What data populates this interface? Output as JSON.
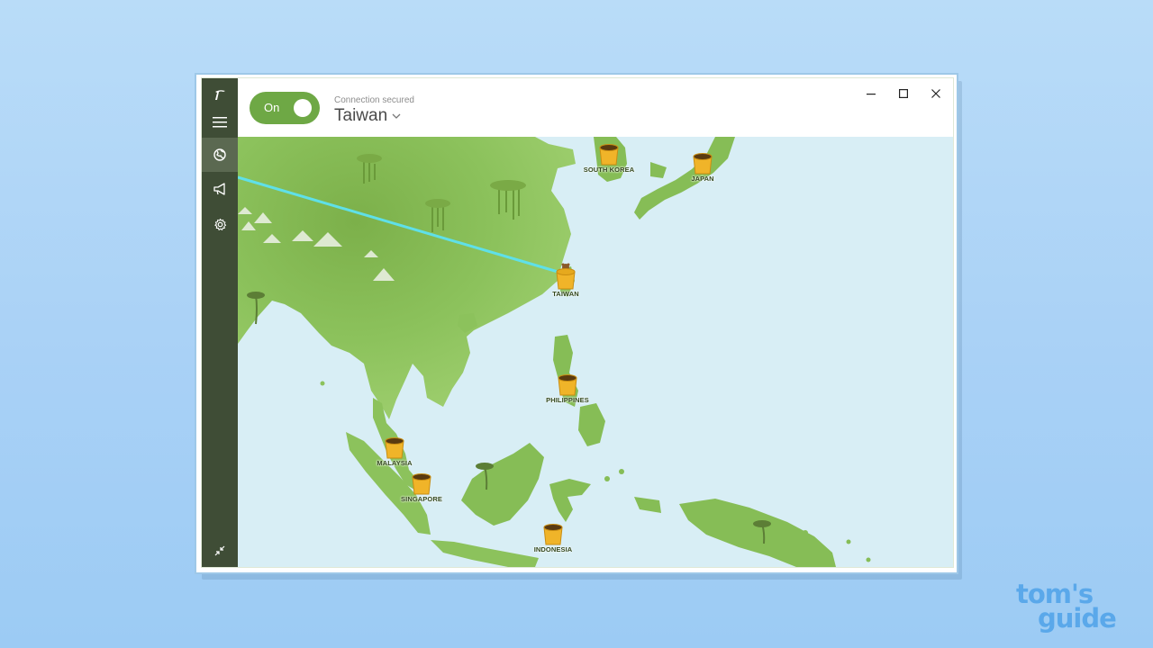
{
  "header": {
    "toggle_label": "On",
    "connection_status": "Connection secured",
    "selected_country": "Taiwan"
  },
  "sidebar": {
    "items": [
      {
        "icon": "tunnelbear-logo-icon"
      },
      {
        "icon": "menu-icon"
      },
      {
        "icon": "globe-icon"
      },
      {
        "icon": "megaphone-icon"
      },
      {
        "icon": "gear-icon"
      },
      {
        "icon": "minimize-view-icon"
      }
    ]
  },
  "window_controls": [
    "minimize",
    "maximize",
    "close"
  ],
  "map": {
    "countries": [
      {
        "name": "SOUTH KOREA"
      },
      {
        "name": "JAPAN"
      },
      {
        "name": "TAIWAN",
        "connected": true
      },
      {
        "name": "PHILIPPINES"
      },
      {
        "name": "MALAYSIA"
      },
      {
        "name": "SINGAPORE"
      },
      {
        "name": "INDONESIA"
      }
    ]
  },
  "branding": {
    "line1": "tom's",
    "line2": "guide"
  },
  "colors": {
    "toggle_on": "#6ea845",
    "sidebar": "#3f4d36",
    "sea": "#d8eef5",
    "land": "#8dbf5b",
    "tunnel_line": "#5fe0e8",
    "logo": "#5aa8ea"
  }
}
